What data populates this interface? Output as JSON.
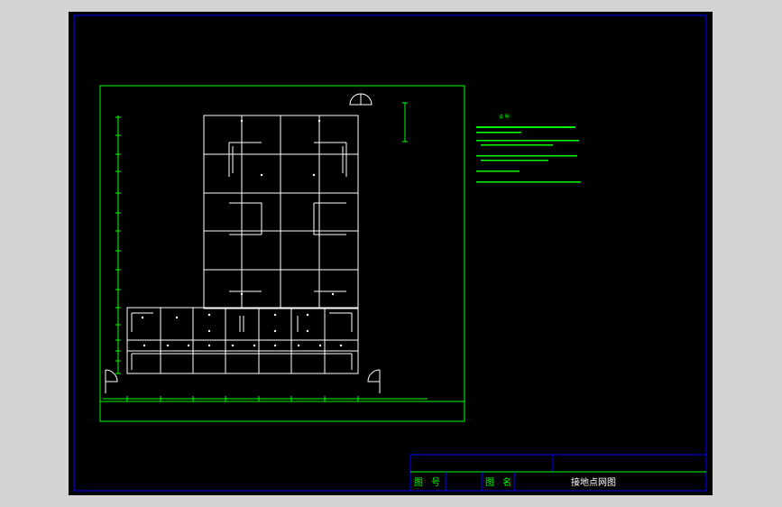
{
  "title_block": {
    "drawing_number_label": "图 号",
    "drawing_name_label": "图 名",
    "drawing_name": "接地点网图"
  },
  "notes": {
    "heading": "说 明"
  },
  "colors": {
    "background": "#000000",
    "frame": "#0000ff",
    "grid_lines": "#ffffff",
    "annotation": "#00ff00",
    "window": "#d4d4d4"
  },
  "icons": {
    "north_arrow": "compass-icon",
    "doors": "door-swing-icon"
  }
}
